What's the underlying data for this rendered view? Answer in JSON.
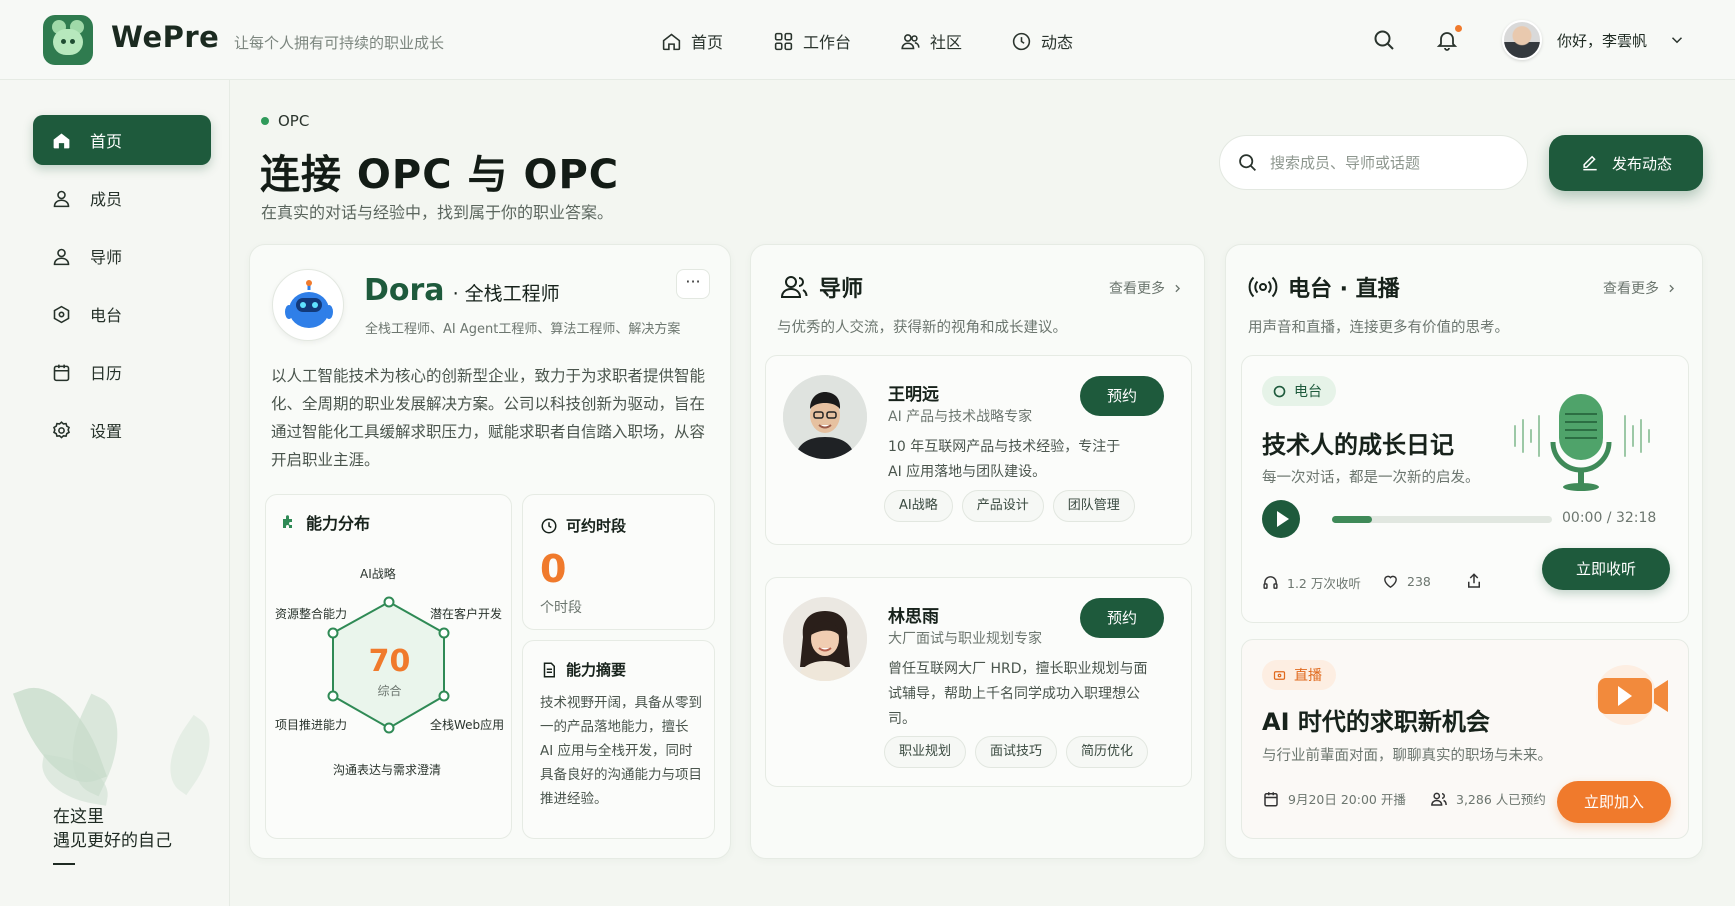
{
  "app": {
    "brand": "WePre",
    "tagline": "让每个人拥有可持续的职业成长",
    "accent": "#1e5a3c",
    "orange": "#f07a2c"
  },
  "nav": {
    "items": [
      {
        "label": "首页",
        "icon": "home-icon"
      },
      {
        "label": "工作台",
        "icon": "grid-icon"
      },
      {
        "label": "社区",
        "icon": "community-icon"
      },
      {
        "label": "动态",
        "icon": "clock-icon"
      }
    ],
    "user_greeting": "你好，李雲帆"
  },
  "sidebar": {
    "items": [
      {
        "label": "首页",
        "icon": "home-icon",
        "active": true
      },
      {
        "label": "成员",
        "icon": "user-icon"
      },
      {
        "label": "导师",
        "icon": "mentor-icon"
      },
      {
        "label": "电台",
        "icon": "radio-icon"
      },
      {
        "label": "日历",
        "icon": "calendar-icon"
      },
      {
        "label": "设置",
        "icon": "gear-icon"
      }
    ],
    "slogan_line1": "在这里",
    "slogan_line2": "遇见更好的自己"
  },
  "header": {
    "kicker": "OPC",
    "title": "连接 OPC 与 OPC",
    "subtitle": "在真实的对话与经验中，找到属于你的职业答案。",
    "search_placeholder": "搜索成员、导师或话题",
    "publish_label": "发布动态"
  },
  "profile": {
    "name": "Dora",
    "role": "· 全栈工程师",
    "tags_line": "全栈工程师、AI Agent工程师、算法工程师、解决方案",
    "description": "以人工智能技术为核心的创新型企业，致力于为求职者提供智能化、全周期的职业发展解决方案。公司以科技创新为驱动，旨在通过智能化工具缓解求职压力，赋能求职者自信踏入职场，从容开启职业主涯。",
    "ability": {
      "title": "能力分布",
      "score": "70",
      "score_label": "综合",
      "axes": [
        "AI战略",
        "潜在客户开发",
        "全栈Web应用",
        "沟通表达与需求澄清",
        "项目推进能力",
        "资源整合能力"
      ]
    },
    "slots": {
      "title": "可约时段",
      "count": "0",
      "unit": "个时段"
    },
    "summary": {
      "title": "能力摘要",
      "text": "技术视野开阔，具备从零到一的产品落地能力，擅长 AI 应用与全栈开发，同时具备良好的沟通能力与项目推进经验。"
    }
  },
  "mentors": {
    "title": "导师",
    "more": "查看更多",
    "subtitle": "与优秀的人交流，获得新的视角和成长建议。",
    "book_label": "预约",
    "list": [
      {
        "name": "王明远",
        "title": "AI 产品与技术战略专家",
        "bio": "10 年互联网产品与技术经验，专注于 AI 应用落地与团队建设。",
        "tags": [
          "AI战略",
          "产品设计",
          "团队管理"
        ]
      },
      {
        "name": "林思雨",
        "title": "大厂面试与职业规划专家",
        "bio": "曾任互联网大厂 HRD，擅长职业规划与面试辅导，帮助上千名同学成功入职理想公司。",
        "tags": [
          "职业规划",
          "面试技巧",
          "简历优化"
        ]
      }
    ]
  },
  "radio": {
    "title": "电台 · 直播",
    "more": "查看更多",
    "subtitle": "用声音和直播，连接更多有价值的思考。",
    "episode": {
      "badge": "电台",
      "title": "技术人的成长日记",
      "desc": "每一次对话，都是一次新的启发。",
      "time": "00:00 / 32:18",
      "progress": 0.18,
      "listens": "1.2 万次收听",
      "likes": "238",
      "listen_label": "立即收听"
    },
    "live": {
      "badge": "直播",
      "title": "AI 时代的求职新机会",
      "desc": "与行业前輩面对面，聊聊真实的职场与未来。",
      "date": "9月20日 20:00 开播",
      "reserved": "3,286 人已预约",
      "join_label": "立即加入"
    }
  }
}
